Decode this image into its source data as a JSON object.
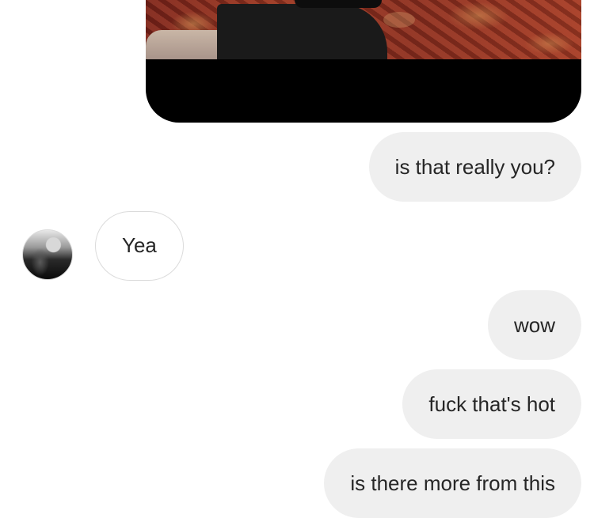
{
  "thread": {
    "messages": [
      {
        "direction": "sent",
        "type": "image"
      },
      {
        "direction": "sent",
        "type": "text",
        "text": "is that really you?"
      },
      {
        "direction": "received",
        "type": "text",
        "text": "Yea"
      },
      {
        "direction": "sent",
        "type": "text",
        "text": "wow"
      },
      {
        "direction": "sent",
        "type": "text",
        "text": "fuck that's hot"
      },
      {
        "direction": "sent",
        "type": "text",
        "text": "is there more from this"
      }
    ],
    "sender_avatar": {
      "icon": "profile-photo"
    }
  },
  "colors": {
    "sent_bubble": "#efefef",
    "received_border": "#dbdbdb",
    "text": "#262626"
  }
}
